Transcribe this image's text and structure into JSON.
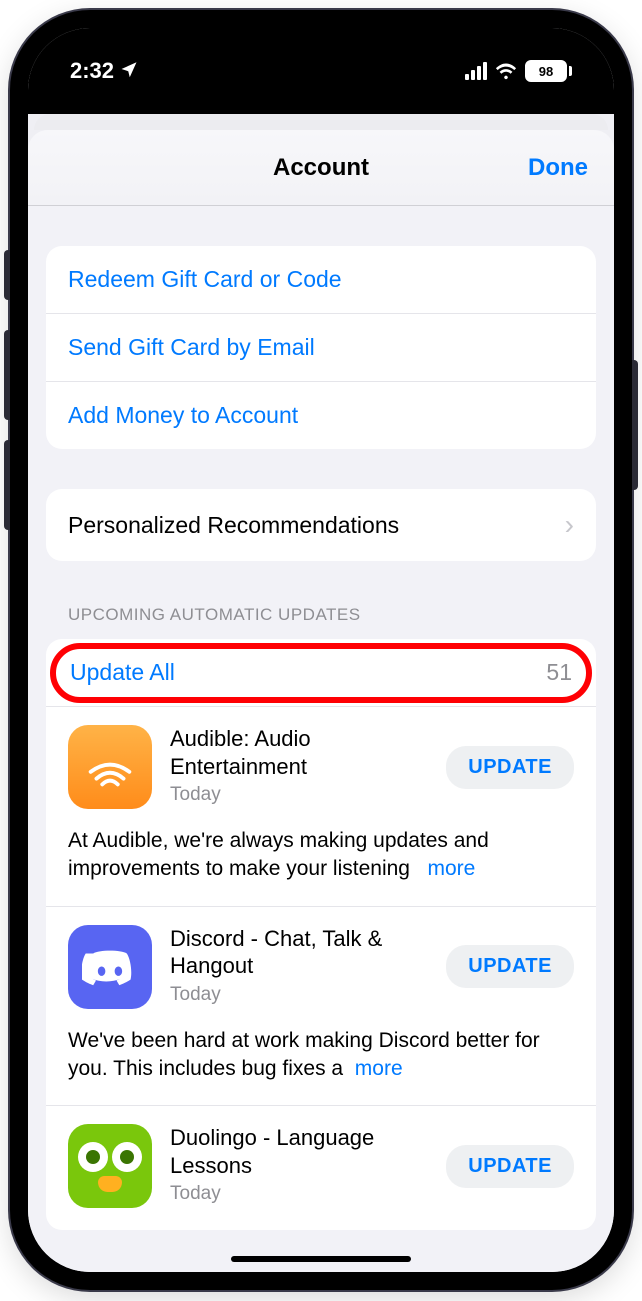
{
  "status_bar": {
    "time": "2:32",
    "battery_pct": "98"
  },
  "nav": {
    "title": "Account",
    "done": "Done"
  },
  "gift_card_section": {
    "redeem": "Redeem Gift Card or Code",
    "send": "Send Gift Card by Email",
    "add_money": "Add Money to Account"
  },
  "recommendations": {
    "label": "Personalized Recommendations"
  },
  "updates_section": {
    "header": "Upcoming Automatic Updates",
    "update_all_label": "Update All",
    "update_all_count": "51",
    "update_button": "UPDATE",
    "more": "more",
    "apps": [
      {
        "name": "Audible: Audio Entertainment",
        "date": "Today",
        "desc": "At Audible, we're always making updates and improvements to make your listening"
      },
      {
        "name": "Discord - Chat, Talk & Hangout",
        "date": "Today",
        "desc": "We've been hard at work making Discord better for you. This includes bug fixes a"
      },
      {
        "name": "Duolingo - Language Lessons",
        "date": "Today",
        "desc": ""
      }
    ]
  }
}
